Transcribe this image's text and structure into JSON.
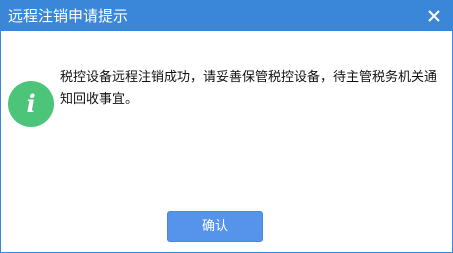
{
  "window": {
    "title": "远程注销申请提示",
    "close_icon": "close-icon"
  },
  "dialog": {
    "icon": "info-icon",
    "icon_glyph": "i",
    "icon_color": "#4cc57a",
    "message": "税控设备远程注销成功，请妥善保管税控设备，待主管税务机关通知回收事宜。",
    "ok_label": "确认"
  },
  "colors": {
    "titlebar": "#3a86d8",
    "button": "#5694eb",
    "border": "#3a86d8"
  }
}
